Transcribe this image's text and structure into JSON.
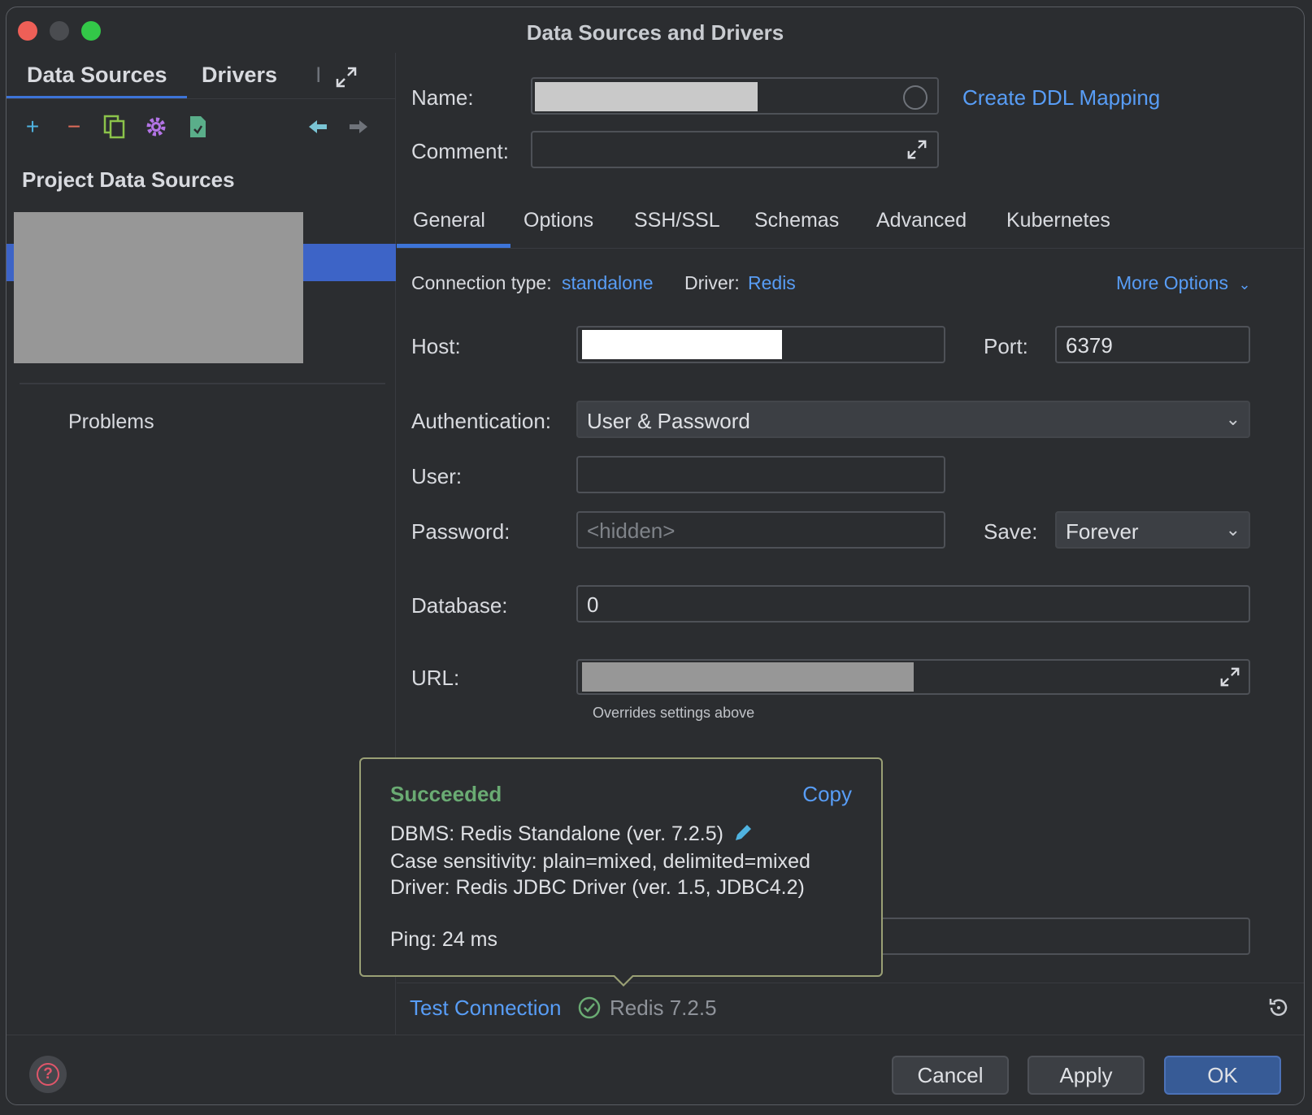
{
  "window": {
    "title": "Data Sources and Drivers"
  },
  "left_tabs": {
    "data_sources": "Data Sources",
    "drivers": "Drivers",
    "more": "I"
  },
  "left": {
    "section_title": "Project Data Sources",
    "problems": "Problems"
  },
  "form": {
    "name_label": "Name:",
    "comment_label": "Comment:",
    "create_ddl": "Create DDL Mapping",
    "tabs": [
      "General",
      "Options",
      "SSH/SSL",
      "Schemas",
      "Advanced",
      "Kubernetes"
    ],
    "connection_type_label": "Connection type:",
    "connection_type_value": "standalone",
    "driver_label": "Driver:",
    "driver_value": "Redis",
    "more_options": "More Options",
    "host_label": "Host:",
    "port_label": "Port:",
    "port_value": "6379",
    "auth_label": "Authentication:",
    "auth_value": "User & Password",
    "user_label": "User:",
    "password_label": "Password:",
    "password_placeholder": "<hidden>",
    "save_label": "Save:",
    "save_value": "Forever",
    "database_label": "Database:",
    "database_value": "0",
    "url_label": "URL:",
    "url_hint": "Overrides settings above"
  },
  "popup": {
    "status": "Succeeded",
    "copy": "Copy",
    "dbms": "DBMS: Redis Standalone (ver. 7.2.5)",
    "case": "Case sensitivity: plain=mixed, delimited=mixed",
    "driver": "Driver: Redis JDBC Driver (ver. 1.5, JDBC4.2)",
    "ping": "Ping: 24 ms"
  },
  "test": {
    "label": "Test Connection",
    "result": "Redis 7.2.5"
  },
  "footer": {
    "cancel": "Cancel",
    "apply": "Apply",
    "ok": "OK"
  },
  "colors": {
    "accent": "#3d74d8",
    "link": "#589df6",
    "success": "#6aab73"
  }
}
